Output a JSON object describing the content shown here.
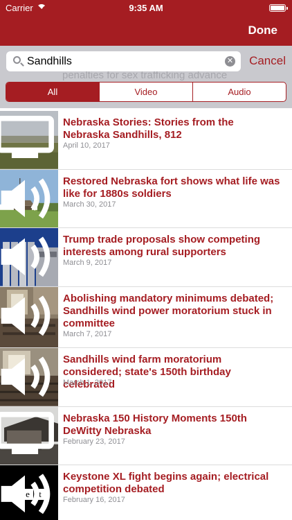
{
  "status_bar": {
    "carrier": "Carrier",
    "time": "9:35 AM"
  },
  "nav": {
    "done_label": "Done"
  },
  "search": {
    "value": "Sandhills",
    "cancel_label": "Cancel",
    "background_text": "penalties for sex trafficking advance"
  },
  "filter_tabs": [
    {
      "label": "All",
      "selected": true
    },
    {
      "label": "Video",
      "selected": false
    },
    {
      "label": "Audio",
      "selected": false
    }
  ],
  "results": [
    {
      "title": "Nebraska Stories: Stories from the Nebraska Sandhills, 812",
      "date": "April 10, 2017",
      "media": "tv-icon"
    },
    {
      "title": "Restored Nebraska fort shows what life was like for 1880s soldiers",
      "date": "March 30, 2017",
      "media": "speaker-icon"
    },
    {
      "title": "Trump trade proposals show competing interests among rural supporters",
      "date": "March 9, 2017",
      "media": "speaker-icon"
    },
    {
      "title": "Abolishing mandatory minimums debated; Sandhills wind power moratorium stuck in committee",
      "date": "March 7, 2017",
      "media": "speaker-icon"
    },
    {
      "title": "Sandhills wind farm moratorium considered; state's 150th birthday celebrated",
      "date": "March 1, 2017",
      "media": "speaker-icon"
    },
    {
      "title": "Nebraska 150 History Moments 150th DeWitty Nebraska",
      "date": "February 23, 2017",
      "media": "tv-icon"
    },
    {
      "title": "Keystone XL fight begins again; electrical competition debated",
      "date": "February 16, 2017",
      "media": "speaker-icon"
    }
  ],
  "logo_text": "net",
  "colors": {
    "brand_red": "#a51d22",
    "search_bar_bg": "#c9c9ce",
    "date_gray": "#8e8e93"
  }
}
